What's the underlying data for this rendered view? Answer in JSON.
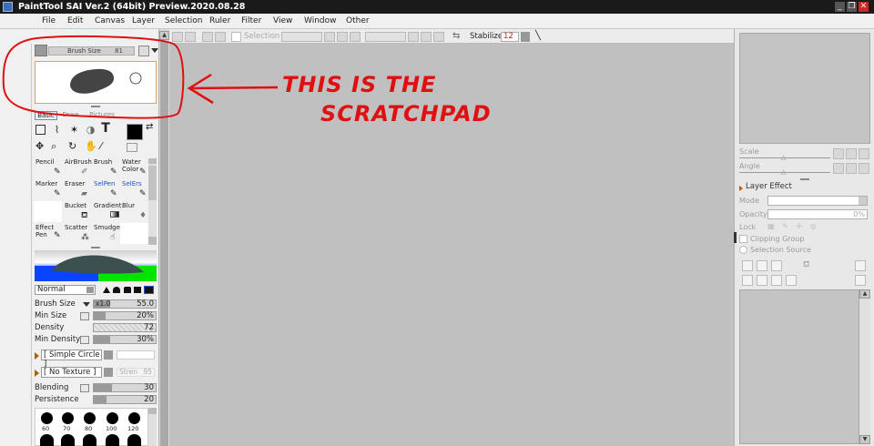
{
  "window": {
    "title": "PaintTool SAI Ver.2 (64bit) Preview.2020.08.28",
    "min_glyph": "_",
    "max_glyph": "❐",
    "close_glyph": "✕"
  },
  "menu": [
    "File",
    "Edit",
    "Canvas",
    "Layer",
    "Selection",
    "Ruler",
    "Filter",
    "View",
    "Window",
    "Other"
  ],
  "canvas_toolbar": {
    "selection_label": "Selection",
    "stabilizer_label": "Stabilizer",
    "stabilizer_value": "12"
  },
  "left": {
    "brush_size_label": "Brush Size",
    "brush_size_short": "81",
    "tabs": [
      "Basic",
      "Draw",
      "Pictures"
    ],
    "tools": [
      {
        "name": "Pencil",
        "sel": false
      },
      {
        "name": "AirBrush",
        "sel": false
      },
      {
        "name": "Brush",
        "sel": false
      },
      {
        "name": "Water Color",
        "sel": false
      },
      {
        "name": "Marker",
        "sel": false
      },
      {
        "name": "Eraser",
        "sel": false
      },
      {
        "name": "SelPen",
        "sel": false,
        "blue": true
      },
      {
        "name": "SelErs",
        "sel": false,
        "blue": true
      },
      {
        "name": "",
        "sel": true
      },
      {
        "name": "Bucket",
        "sel": false
      },
      {
        "name": "Gradient",
        "sel": false
      },
      {
        "name": "Blur",
        "sel": false
      },
      {
        "name": "Effect Pen",
        "sel": false
      },
      {
        "name": "Scatter",
        "sel": false
      },
      {
        "name": "Smudge",
        "sel": false
      },
      {
        "name": "",
        "sel": true
      }
    ],
    "blend_mode": "Normal",
    "params": {
      "brush_size_label": "Brush Size",
      "brush_size_mult": "x1.0",
      "brush_size_value": "55.0",
      "min_size_label": "Min Size",
      "min_size_value": "20%",
      "density_label": "Density",
      "density_value": "72",
      "min_density_label": "Min Density",
      "min_density_value": "30%"
    },
    "shape": "[ Simple Circle ]",
    "texture": "[ No Texture ]",
    "texture_strength_label": "Stren",
    "texture_strength_value": "95",
    "blending_label": "Blending",
    "blending_value": "30",
    "persistence_label": "Persistence",
    "persistence_value": "20",
    "brush_sizes": [
      "60",
      "70",
      "80",
      "100",
      "120"
    ]
  },
  "right": {
    "scale_label": "Scale",
    "angle_label": "Angle",
    "layer_effect_label": "Layer Effect",
    "mode_label": "Mode",
    "opacity_label": "Opacity",
    "opacity_value": "0%",
    "lock_label": "Lock",
    "clipping_label": "Clipping Group",
    "selection_source_label": "Selection Source"
  },
  "annotation": {
    "line1": "THIS IS THE",
    "line2": "SCRATCHPAD",
    "color": "#e01010"
  }
}
